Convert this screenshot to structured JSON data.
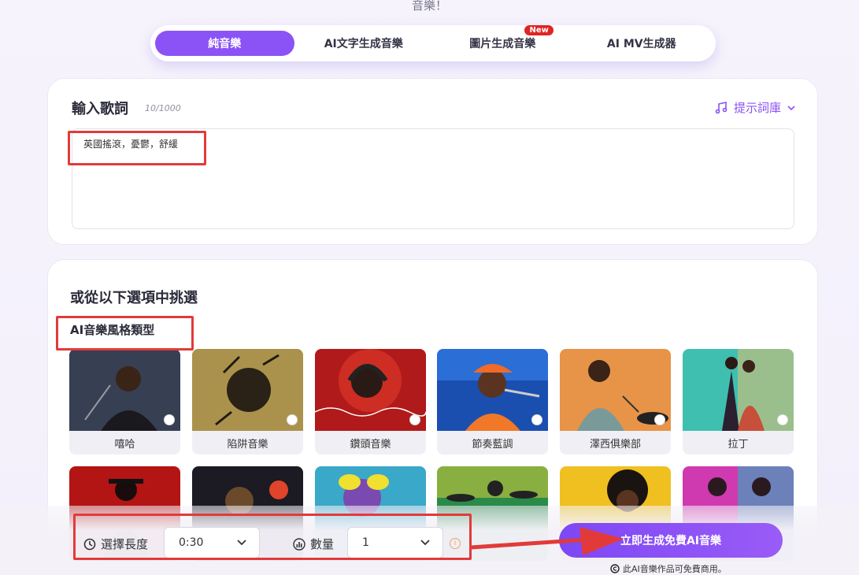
{
  "top_caption": "音樂！",
  "tabs": [
    {
      "label": "純音樂",
      "active": true
    },
    {
      "label": "AI文字生成音樂"
    },
    {
      "label": "圖片生成音樂",
      "badge": "New"
    },
    {
      "label": "AI MV生成器"
    }
  ],
  "lyrics": {
    "title": "輸入歌詞",
    "count": "10/1000",
    "prompt_library": "提示詞庫",
    "value": "英國搖滾，憂鬱，舒緩"
  },
  "styles": {
    "choose_title": "或從以下選項中挑選",
    "type_title": "AI音樂風格類型",
    "items": [
      {
        "label": "嘻哈",
        "icon": "hiphop-singer"
      },
      {
        "label": "陷阱音樂",
        "icon": "trap-portrait"
      },
      {
        "label": "鑽頭音樂",
        "icon": "drill-headphones"
      },
      {
        "label": "節奏藍調",
        "icon": "rnb-singer"
      },
      {
        "label": "澤西俱樂部",
        "icon": "jersey-drummer"
      },
      {
        "label": "拉丁",
        "icon": "latin-dancers"
      }
    ]
  },
  "controls": {
    "length_label": "選擇長度",
    "length_value": "0:30",
    "count_label": "數量",
    "count_value": "1",
    "generate_button": "立即生成免費AI音樂",
    "free_note": "此AI音樂作品可免費商用。"
  },
  "colors": {
    "accent": "#8b52f6",
    "highlight": "#e23a3a"
  }
}
